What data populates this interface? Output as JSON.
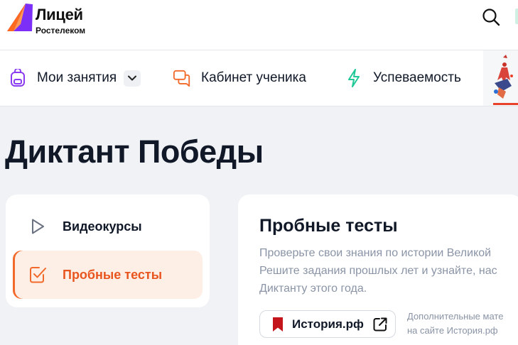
{
  "header": {
    "logo_title": "Лицей",
    "logo_subtitle": "Ростелеком",
    "search_icon": "search-icon",
    "brand_colors": {
      "purple": "#7b2ff7",
      "orange": "#ff6a1f"
    }
  },
  "nav": {
    "items": [
      {
        "label": "Мои занятия",
        "icon": "backpack-icon",
        "has_dropdown": true
      },
      {
        "label": "Кабинет ученика",
        "icon": "chat-bubbles-icon"
      },
      {
        "label": "Успеваемость",
        "icon": "lightning-icon"
      }
    ],
    "banner_icon": "event-banner-icon"
  },
  "page": {
    "title": "Диктант Победы"
  },
  "sidebar": {
    "items": [
      {
        "label": "Видеокурсы",
        "icon": "play-icon",
        "active": false
      },
      {
        "label": "Пробные тесты",
        "icon": "checkbox-icon",
        "active": true
      }
    ],
    "accent_color": "#f26a2b"
  },
  "content": {
    "title": "Пробные тесты",
    "description": "Проверьте свои знания по истории Великой\nРешите задания прошлых лет и узнайте, нас\nДиктанту этого года.",
    "link_label": "История.рф",
    "link_icon": "external-link-icon",
    "note": "Дополнительные мате\nна сайте История.рф"
  }
}
